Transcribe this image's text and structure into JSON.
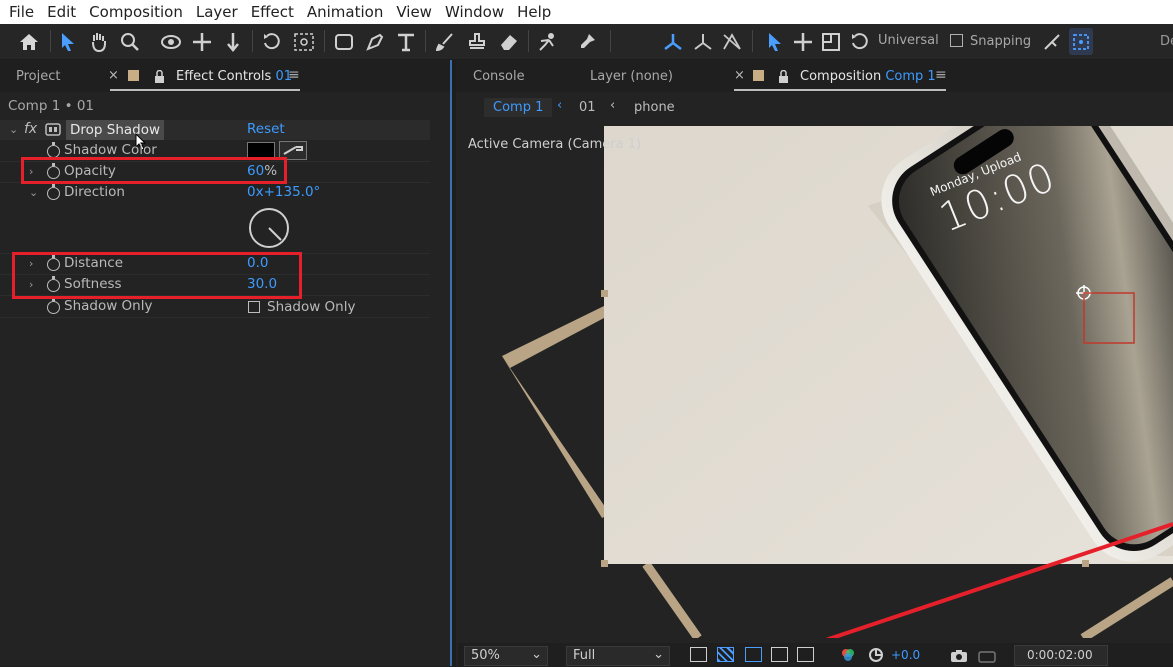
{
  "menu": [
    "File",
    "Edit",
    "Composition",
    "Layer",
    "Effect",
    "Animation",
    "View",
    "Window",
    "Help"
  ],
  "toolbar": {
    "universal_label": "Universal",
    "snapping_label": "Snapping",
    "edge_label": "De"
  },
  "left_panel": {
    "tab_project": "Project",
    "tab_effect_controls": "Effect Controls",
    "tab_effect_controls_layer": "01",
    "layer_path": "Comp 1 • 01",
    "fx_label": "fx",
    "effect_name": "Drop Shadow",
    "reset_label": "Reset",
    "properties": {
      "shadow_color": {
        "label": "Shadow Color"
      },
      "opacity": {
        "label": "Opacity",
        "value": "60",
        "unit": "%"
      },
      "direction": {
        "label": "Direction",
        "value": "0x+135.0°"
      },
      "distance": {
        "label": "Distance",
        "value": "0.0"
      },
      "softness": {
        "label": "Softness",
        "value": "30.0"
      },
      "shadow_only": {
        "label": "Shadow Only",
        "checkbox_label": "Shadow Only"
      }
    }
  },
  "right_panel": {
    "tab_console": "Console",
    "tab_layer": "Layer (none)",
    "tab_composition": "Composition",
    "tab_composition_name": "Comp 1",
    "breadcrumb": [
      "Comp 1",
      "01",
      "phone"
    ],
    "active_camera_label": "Active Camera (Camera 1)",
    "phone_screen": {
      "date": "Monday, Upload",
      "time": "10:00"
    }
  },
  "bottom_bar": {
    "zoom": "50%",
    "resolution": "Full",
    "exposure": "+0.0",
    "timecode": "0:00:02:00"
  },
  "colors": {
    "accent_blue": "#3d9bff",
    "highlight_red": "#e5202a",
    "panel_bg": "#232323"
  }
}
